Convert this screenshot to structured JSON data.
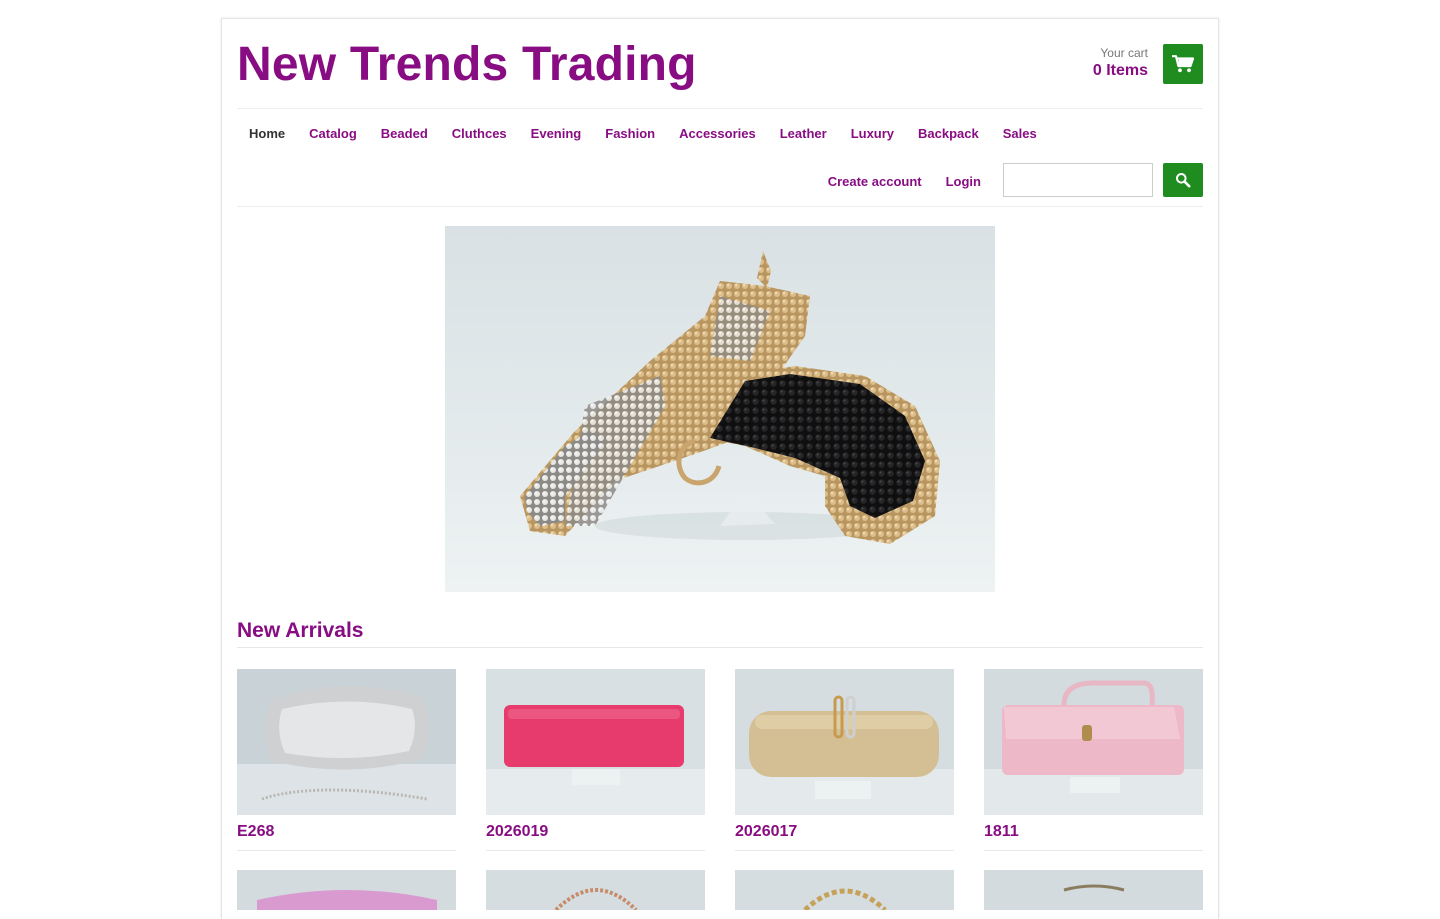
{
  "store": {
    "name": "New Trends Trading"
  },
  "cart": {
    "label": "Your cart",
    "count": "0 Items",
    "icon": "cart-icon"
  },
  "nav": {
    "items": [
      "Home",
      "Catalog",
      "Beaded",
      "Cluthces",
      "Evening",
      "Fashion",
      "Accessories",
      "Leather",
      "Luxury",
      "Backpack",
      "Sales"
    ],
    "active": "Home"
  },
  "account": {
    "create": "Create account",
    "login": "Login"
  },
  "search": {
    "value": "",
    "icon": "search-icon"
  },
  "colors": {
    "brand": "#880d83",
    "accent": "#1e8c1e",
    "text": "#333333",
    "muted": "#777777"
  },
  "new_arrivals": {
    "title": "New Arrivals",
    "products": [
      {
        "name": "E268"
      },
      {
        "name": "2026019"
      },
      {
        "name": "2026017"
      },
      {
        "name": "1811"
      }
    ]
  }
}
